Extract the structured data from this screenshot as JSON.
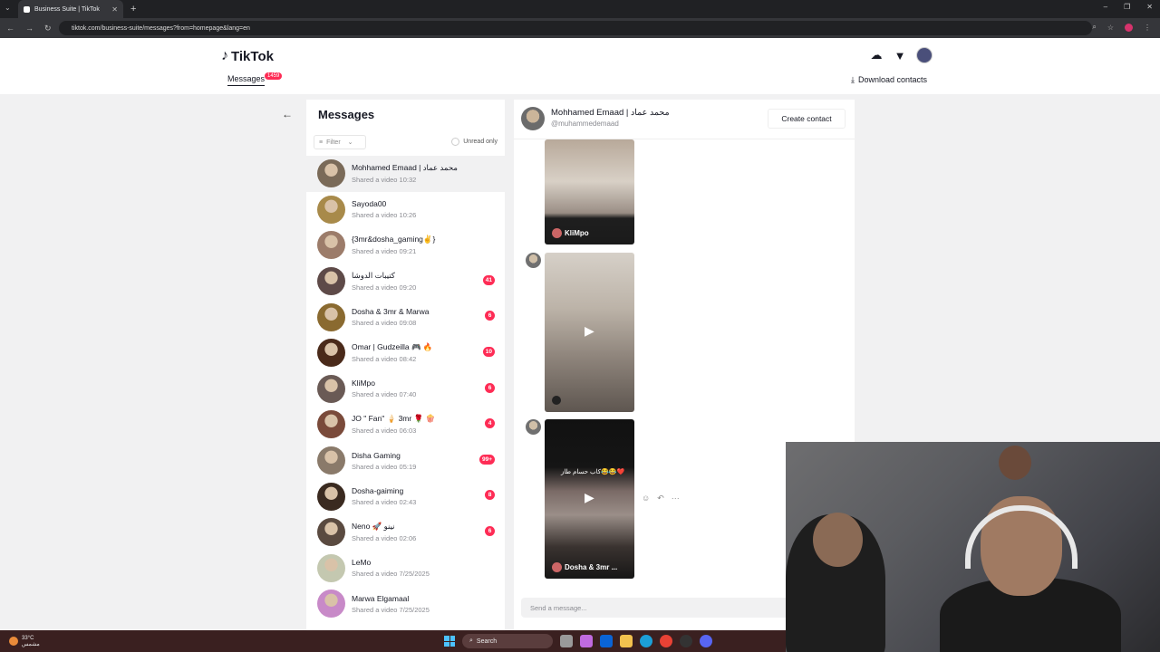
{
  "browser": {
    "tab_title": "Business Suite | TikTok",
    "url": "tiktok.com/business-suite/messages?from=homepage&lang=en"
  },
  "header": {
    "logo": "TikTok",
    "nav_messages": "Messages",
    "nav_badge": "1459",
    "download": "Download contacts"
  },
  "inbox": {
    "title": "Messages",
    "filter": "Filter",
    "unread_only": "Unread only",
    "conversations": [
      {
        "name": "Mohhamed Emaad | محمد عماد",
        "sub": "Shared a video 10:32",
        "badge": "",
        "color": "#7a6a58"
      },
      {
        "name": "Sayoda00",
        "sub": "Shared a video 10:26",
        "badge": "",
        "color": "#a88a4a"
      },
      {
        "name": "{3mr&dosha_gaming✌️}",
        "sub": "Shared a video 09:21",
        "badge": "",
        "color": "#9c7c6a"
      },
      {
        "name": "كتيبات الدوشا",
        "sub": "Shared a video 09:20",
        "badge": "41",
        "color": "#5e4a48"
      },
      {
        "name": "Dosha & 3mr & Marwa",
        "sub": "Shared a video 09:08",
        "badge": "6",
        "color": "#8a6a30"
      },
      {
        "name": "Omar | Gudzeilla 🎮 🔥",
        "sub": "Shared a video 08:42",
        "badge": "10",
        "color": "#4a2a1a"
      },
      {
        "name": "KliMpo",
        "sub": "Shared a video 07:40",
        "badge": "6",
        "color": "#6a5a55"
      },
      {
        "name": "JO \" Fan\" 🍦 3mr 🌹 🍿",
        "sub": "Shared a video 06:03",
        "badge": "4",
        "color": "#7a4a3a"
      },
      {
        "name": "Disha Gaming",
        "sub": "Shared a video 05:19",
        "badge": "99+",
        "color": "#8a7a6a"
      },
      {
        "name": "Dosha-gaiming",
        "sub": "Shared a video 02:43",
        "badge": "8",
        "color": "#3a2a20"
      },
      {
        "name": "Neno 🚀 نينو",
        "sub": "Shared a video 02:06",
        "badge": "6",
        "color": "#5a4a40"
      },
      {
        "name": "LeMo",
        "sub": "Shared a video 7/25/2025",
        "badge": "",
        "color": "#c4c8b0"
      },
      {
        "name": "Marwa Elgamaal",
        "sub": "Shared a video 7/25/2025",
        "badge": "",
        "color": "#c88ac8"
      }
    ]
  },
  "chat": {
    "contact_name": "Mohhamed Emaad | محمد عماد",
    "contact_handle": "@muhammedemaad",
    "create_contact": "Create contact",
    "videos": [
      {
        "caption": "KliMpo",
        "overlay": ""
      },
      {
        "caption": "",
        "overlay": ""
      },
      {
        "caption": "Dosha & 3mr ...",
        "overlay": "كاب حسام طاز😂😂❤️"
      }
    ],
    "composer_placeholder": "Send a message..."
  },
  "taskbar": {
    "weather": "33°C",
    "weather_sub": "مشمس",
    "search": "Search"
  },
  "colors": {
    "accent": "#fe2c55",
    "panel": "#ffffff",
    "background": "#f1f1f2"
  }
}
